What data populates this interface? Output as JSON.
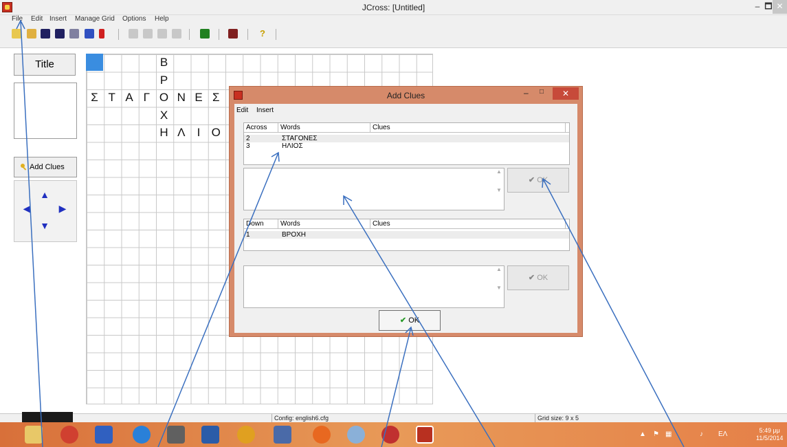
{
  "window": {
    "title": "JCross: [Untitled]",
    "min": "–",
    "max": "🗖",
    "close": "✕"
  },
  "menu": [
    "File",
    "Edit",
    "Insert",
    "Manage Grid",
    "Options",
    "Help"
  ],
  "left_panel": {
    "title_label": "Title",
    "add_clues_label": "Add Clues"
  },
  "grid": {
    "letters": [
      {
        "ch": "Β",
        "col": 4,
        "row": 0
      },
      {
        "ch": "Ρ",
        "col": 4,
        "row": 1
      },
      {
        "ch": "Σ",
        "col": 0,
        "row": 2
      },
      {
        "ch": "Τ",
        "col": 1,
        "row": 2
      },
      {
        "ch": "Α",
        "col": 2,
        "row": 2
      },
      {
        "ch": "Γ",
        "col": 3,
        "row": 2
      },
      {
        "ch": "Ο",
        "col": 4,
        "row": 2
      },
      {
        "ch": "Ν",
        "col": 5,
        "row": 2
      },
      {
        "ch": "Ε",
        "col": 6,
        "row": 2
      },
      {
        "ch": "Σ",
        "col": 7,
        "row": 2
      },
      {
        "ch": "Χ",
        "col": 4,
        "row": 3
      },
      {
        "ch": "Η",
        "col": 4,
        "row": 4
      },
      {
        "ch": "Λ",
        "col": 5,
        "row": 4
      },
      {
        "ch": "Ι",
        "col": 6,
        "row": 4
      },
      {
        "ch": "Ο",
        "col": 7,
        "row": 4
      }
    ]
  },
  "dialog": {
    "title": "Add Clues",
    "min": "–",
    "max": "□",
    "close": "✕",
    "menu": [
      "Edit",
      "Insert"
    ],
    "across": {
      "headers": [
        "Across",
        "Words",
        "Clues"
      ],
      "rows": [
        {
          "num": "2",
          "word": "ΣΤΑΓΟΝΕΣ",
          "clue": ""
        },
        {
          "num": "3",
          "word": "ΗΛΙΟΣ",
          "clue": ""
        }
      ]
    },
    "down": {
      "headers": [
        "Down",
        "Words",
        "Clues"
      ],
      "rows": [
        {
          "num": "1",
          "word": "ΒΡΟΧΗ",
          "clue": ""
        }
      ]
    },
    "ok_label": "OK",
    "main_ok_label": "OK"
  },
  "status": {
    "config": "Config: english6.cfg",
    "grid_size": "Grid size: 9 x 5"
  },
  "taskbar": {
    "lang": "ΕΛ",
    "time": "5:49 μμ",
    "date": "11/5/2014"
  }
}
